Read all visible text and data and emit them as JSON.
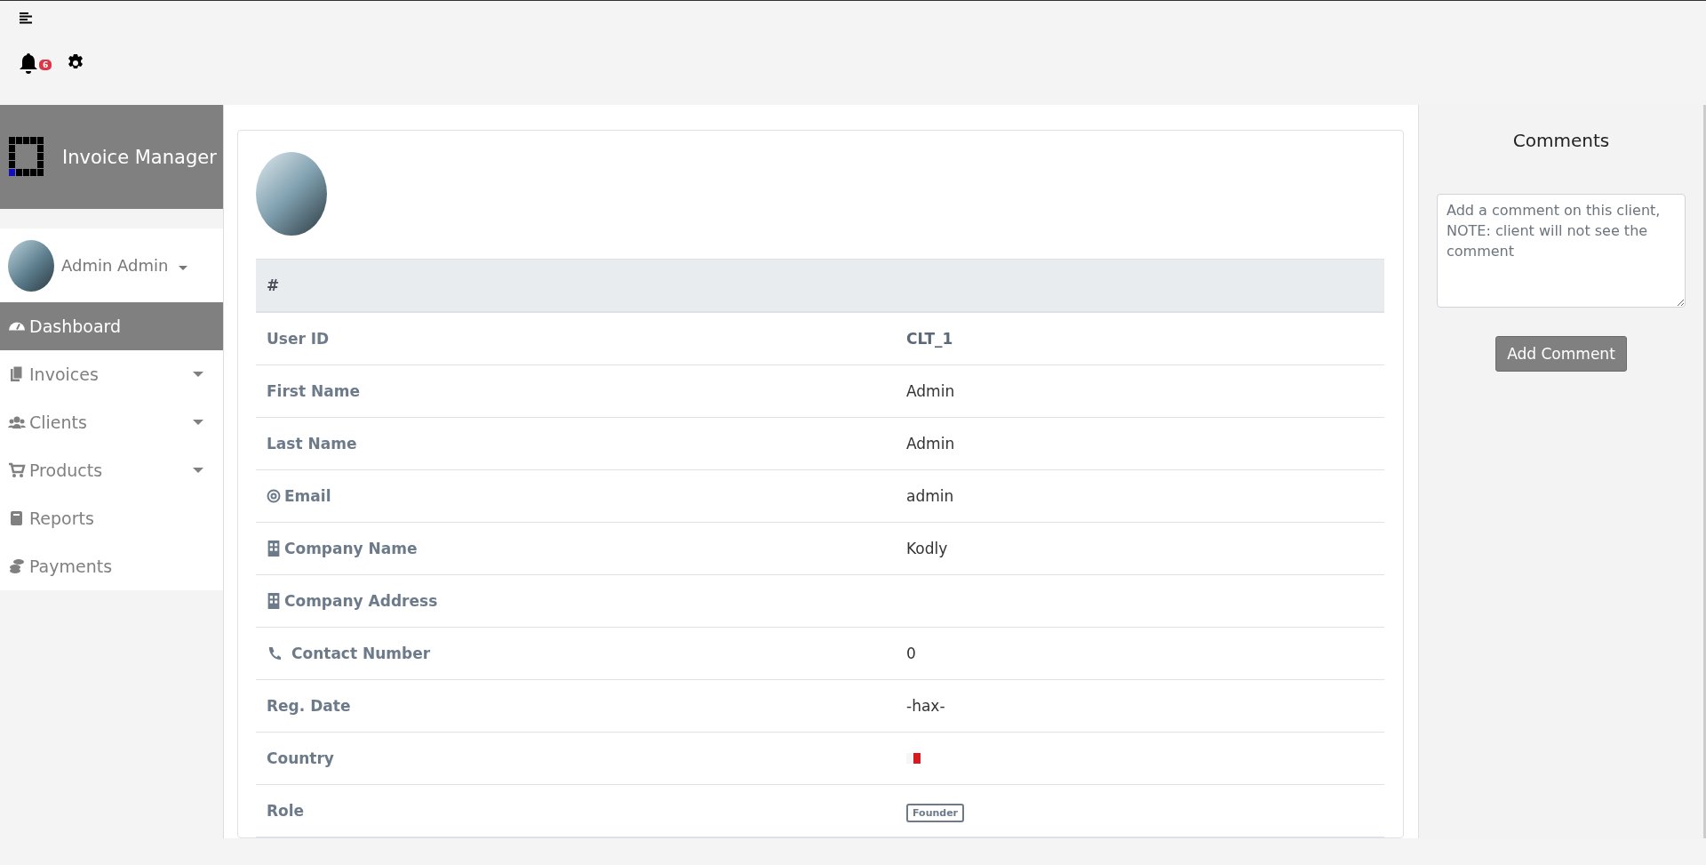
{
  "topbar": {
    "notification_count": "6"
  },
  "sidebar": {
    "brand": "Invoice Manager",
    "user": {
      "name": "Admin Admin"
    },
    "items": [
      {
        "label": "Dashboard",
        "selected": true,
        "has_submenu": false
      },
      {
        "label": "Invoices",
        "selected": false,
        "has_submenu": true
      },
      {
        "label": "Clients",
        "selected": false,
        "has_submenu": true
      },
      {
        "label": "Products",
        "selected": false,
        "has_submenu": true
      },
      {
        "label": "Reports",
        "selected": false,
        "has_submenu": false
      },
      {
        "label": "Payments",
        "selected": false,
        "has_submenu": false
      }
    ]
  },
  "profile": {
    "table": {
      "header": "#",
      "rows": [
        {
          "label": "User ID",
          "kind": "id",
          "value": "CLT_1"
        },
        {
          "label": "First Name",
          "kind": "text",
          "value": "Admin"
        },
        {
          "label": "Last Name",
          "kind": "text",
          "value": "Admin"
        },
        {
          "label": "Email",
          "kind": "text",
          "value": "admin"
        },
        {
          "label": "Company Name",
          "kind": "text",
          "value": "Kodly"
        },
        {
          "label": "Company Address",
          "kind": "text"
        },
        {
          "label": "Contact Number",
          "kind": "text",
          "value": "0"
        },
        {
          "label": "Reg. Date",
          "kind": "text",
          "value": "-hax-"
        },
        {
          "label": "Country",
          "kind": "flag"
        },
        {
          "label": "Role",
          "kind": "badge",
          "value": "Founder"
        }
      ]
    }
  },
  "comments": {
    "title": "Comments",
    "placeholder": "Add a comment on this client, NOTE: client will not see the comment",
    "button": "Add Comment"
  }
}
